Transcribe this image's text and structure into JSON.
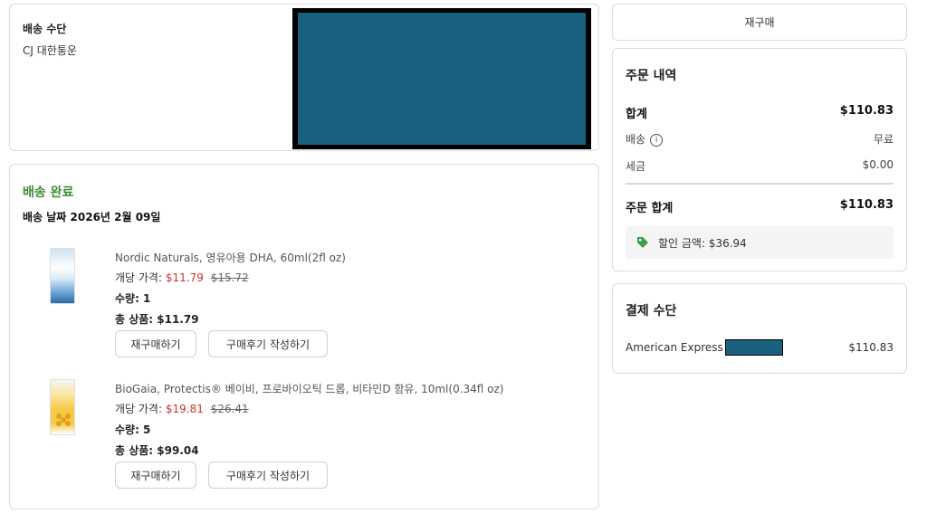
{
  "shipping": {
    "label": "배송 수단",
    "carrier": "CJ 대한통운",
    "redacted_color": "#1a6180"
  },
  "delivery": {
    "status": "배송 완료",
    "status_color": "#3d8b37",
    "date_text": "배송 날짜 2026년 2월 09일",
    "items": [
      {
        "name": "Nordic Naturals, 영유아용 DHA, 60ml(2fl oz)",
        "price_label": "개당 가격:",
        "sale_price": "$11.79",
        "original_price": "$15.72",
        "qty_text": "수량: 1",
        "total_text": "총 상품: $11.79",
        "rebuy_label": "재구매하기",
        "review_label": "구매후기 작성하기",
        "icon": "product-thumbnail"
      },
      {
        "name": "BioGaia, Protectis® 베이비, 프로바이오틱 드롭, 비타민D 함유, 10ml(0.34fl oz)",
        "price_label": "개당 가격:",
        "sale_price": "$19.81",
        "original_price": "$26.41",
        "qty_text": "수량: 5",
        "total_text": "총 상품: $99.04",
        "rebuy_label": "재구매하기",
        "review_label": "구매후기 작성하기",
        "icon": "product-thumbnail"
      }
    ]
  },
  "sidebar": {
    "rebuy_label": "재구매",
    "summary": {
      "title": "주문 내역",
      "subtotal_label": "합계",
      "subtotal_value": "$110.83",
      "shipping_label": "배송",
      "shipping_value": "무료",
      "tax_label": "세금",
      "tax_value": "$0.00",
      "total_label": "주문 합계",
      "total_value": "$110.83",
      "discount_text": "할인 금액: $36.94",
      "discount_icon": "tag-icon",
      "tag_color": "#3d9b4a"
    },
    "payment": {
      "title": "결제 수단",
      "method": "American Express",
      "amount": "$110.83"
    }
  }
}
